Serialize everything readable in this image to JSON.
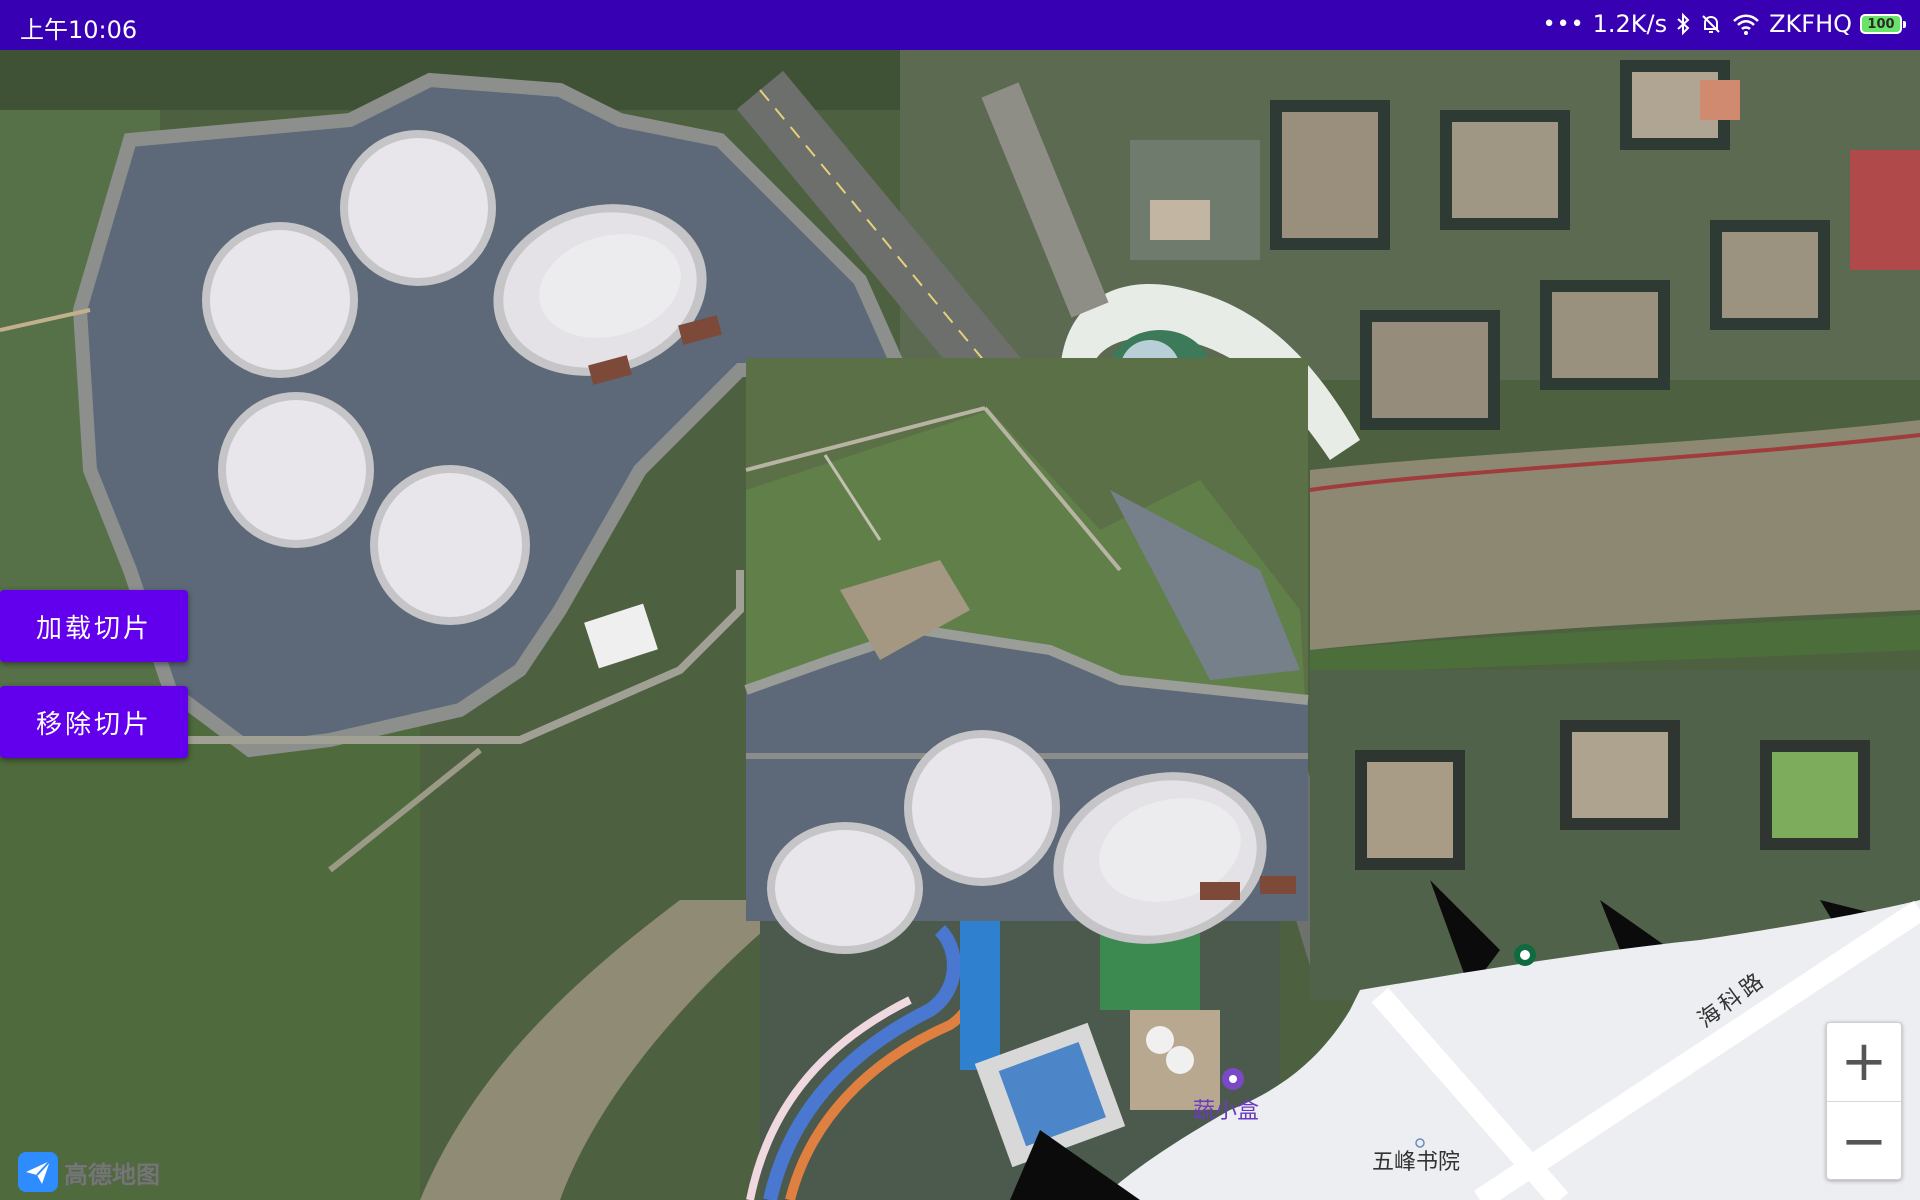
{
  "status_bar": {
    "time": "上午10:06",
    "net_speed": "1.2K/s",
    "wifi_name": "ZKFHQ",
    "battery": "100",
    "dots": "•••",
    "colors": {
      "background": "#3700b3",
      "battery": "#6ae36a"
    }
  },
  "buttons": {
    "load_tiles": "加载切片",
    "remove_tiles": "移除切片",
    "color": "#6200ee"
  },
  "map": {
    "road_label": "海科路",
    "poi_school": "五峰书院",
    "poi_shop": "蔬小盒"
  },
  "zoom": {
    "zoom_in": "+",
    "zoom_out": "−"
  },
  "logo": {
    "text": "高德地图"
  }
}
